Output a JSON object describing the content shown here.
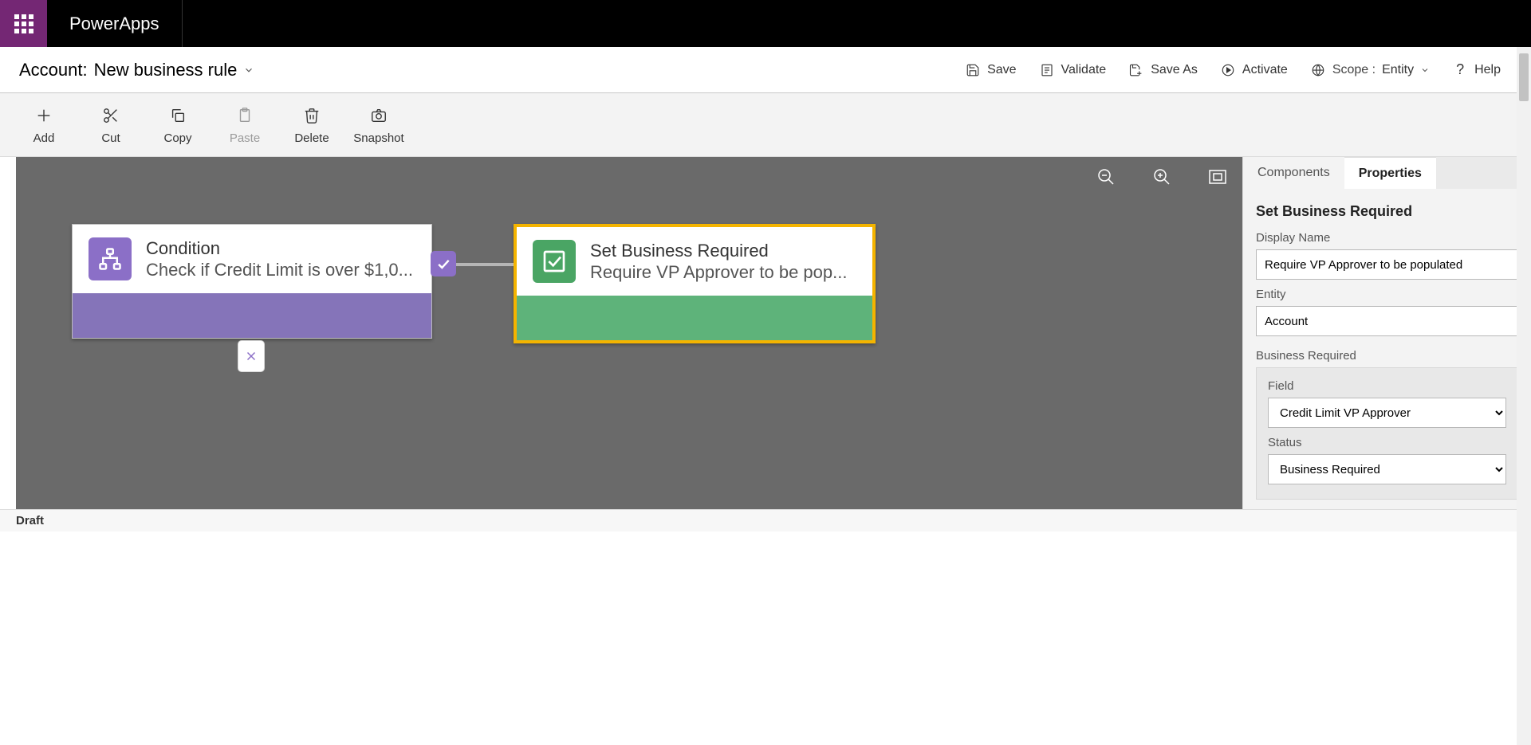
{
  "app": {
    "name": "PowerApps"
  },
  "header": {
    "entity_label": "Account:",
    "rule_name": "New business rule"
  },
  "commands": {
    "save": "Save",
    "validate": "Validate",
    "save_as": "Save As",
    "activate": "Activate",
    "scope_label": "Scope :",
    "scope_value": "Entity",
    "help": "Help"
  },
  "toolbar": {
    "add": "Add",
    "cut": "Cut",
    "copy": "Copy",
    "paste": "Paste",
    "delete": "Delete",
    "snapshot": "Snapshot"
  },
  "canvas": {
    "condition": {
      "title": "Condition",
      "subtitle": "Check if Credit Limit is over $1,0..."
    },
    "action": {
      "title": "Set Business Required",
      "subtitle": "Require VP Approver to be pop..."
    }
  },
  "panel": {
    "tabs": {
      "components": "Components",
      "properties": "Properties"
    },
    "title": "Set Business Required",
    "display_name_label": "Display Name",
    "display_name_value": "Require VP Approver to be populated",
    "entity_label": "Entity",
    "entity_value": "Account",
    "section_label": "Business Required",
    "field_label": "Field",
    "field_value": "Credit Limit VP Approver",
    "status_label": "Status",
    "status_value": "Business Required"
  },
  "status": {
    "text": "Draft"
  }
}
